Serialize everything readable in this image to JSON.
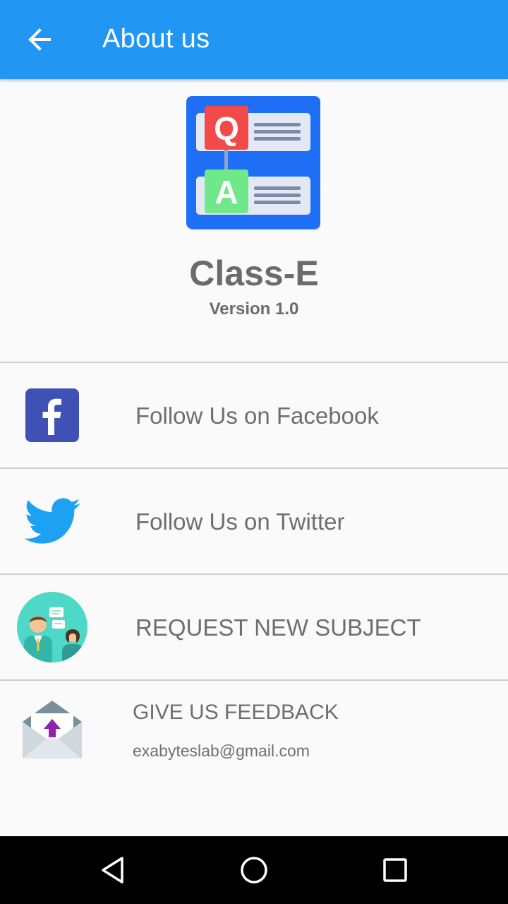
{
  "appbar": {
    "title": "About us",
    "back_icon": "arrow-left-icon",
    "color": "#2196f3"
  },
  "app": {
    "name": "Class-E",
    "version": "Version 1.0",
    "logo": {
      "icon": "qa-app-logo-icon",
      "q_letter": "Q",
      "a_letter": "A"
    }
  },
  "rows": {
    "facebook": {
      "label": "Follow Us on Facebook",
      "icon": "facebook-icon"
    },
    "twitter": {
      "label": "Follow Us on Twitter",
      "icon": "twitter-bird-icon"
    },
    "request": {
      "label": "REQUEST NEW SUBJECT",
      "icon": "people-chat-icon"
    },
    "feedback": {
      "title": "GIVE US FEEDBACK",
      "email": "exabyteslab@gmail.com",
      "icon": "envelope-upload-icon"
    }
  },
  "navbar": {
    "back": "nav-back-triangle-icon",
    "home": "nav-home-circle-icon",
    "recents": "nav-recents-square-icon"
  }
}
